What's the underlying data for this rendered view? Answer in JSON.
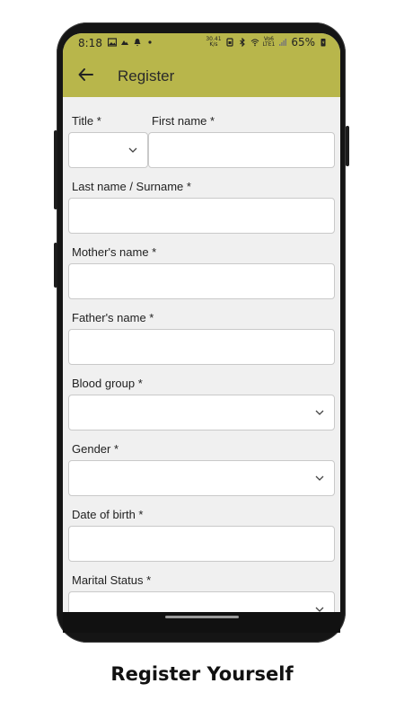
{
  "status_bar": {
    "time": "8:18",
    "net_speed_value": "30.41",
    "net_speed_unit": "K/s",
    "network_label_top": "Vo6",
    "network_label_bottom": "LTE1",
    "battery_percent": "65%"
  },
  "app_bar": {
    "title": "Register",
    "back_icon": "arrow-left-icon"
  },
  "form": {
    "title_label": "Title *",
    "first_name_label": "First name *",
    "last_name_label": "Last name / Surname *",
    "mothers_name_label": "Mother's name *",
    "fathers_name_label": "Father's name *",
    "blood_group_label": "Blood group *",
    "gender_label": "Gender *",
    "dob_label": "Date of birth *",
    "marital_status_label": "Marital Status *"
  },
  "caption": "Register Yourself",
  "colors": {
    "app_bar": "#b8b64b",
    "form_background": "#f0f0f0"
  }
}
